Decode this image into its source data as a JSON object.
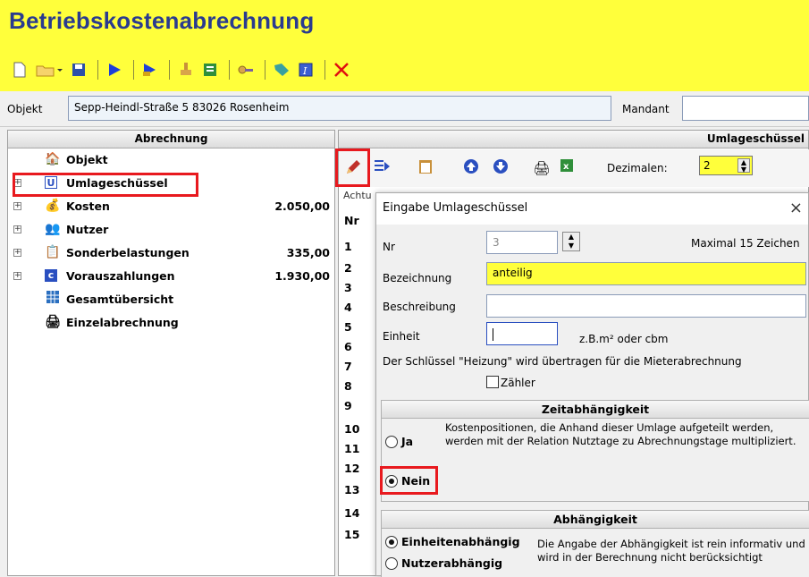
{
  "app": {
    "title": "Betriebskostenabrechnung"
  },
  "toolbar": {
    "icons": [
      "new-file-icon",
      "open-folder-icon",
      "save-icon",
      "run-icon",
      "run-all-icon",
      "stamp-icon",
      "list-icon",
      "key-icon",
      "tag-icon",
      "info-icon",
      "delete-icon"
    ]
  },
  "object": {
    "label": "Objekt",
    "value": "Sepp-Heindl-Straße 5  83026 Rosenheim",
    "mandant_label": "Mandant",
    "mandant_value": ""
  },
  "left": {
    "header": "Abrechnung",
    "items": [
      {
        "label": "Objekt",
        "value": ""
      },
      {
        "label": "Umlageschüssel",
        "value": ""
      },
      {
        "label": "Kosten",
        "value": "2.050,00"
      },
      {
        "label": "Nutzer",
        "value": ""
      },
      {
        "label": "Sonderbelastungen",
        "value": "335,00"
      },
      {
        "label": "Vorauszahlungen",
        "value": "1.930,00"
      },
      {
        "label": "Gesamtübersicht",
        "value": ""
      },
      {
        "label": "Einzelabrechnung",
        "value": ""
      }
    ]
  },
  "right": {
    "header": "Umlageschüssel",
    "dezimalen_label": "Dezimalen:",
    "dezimalen_value": "2",
    "hint_text": "Achtu",
    "nr_header": "Nr",
    "rows": [
      "1",
      "2",
      "3",
      "4",
      "5",
      "6",
      "7",
      "8",
      "9",
      "10",
      "11",
      "12",
      "13",
      "14",
      "15"
    ]
  },
  "dialog": {
    "title": "Eingabe Umlageschüssel",
    "close": "×",
    "nr_label": "Nr",
    "nr_value": "3",
    "max_note": "Maximal 15 Zeichen",
    "bez_label": "Bezeichnung",
    "bez_value": "anteilig",
    "besch_label": "Beschreibung",
    "besch_value": "",
    "einheit_label": "Einheit",
    "einheit_value": "",
    "einheit_hint": "z.B.m² oder cbm",
    "heizung_note": "Der Schlüssel \"Heizung\" wird übertragen für die Mieterabrechnung",
    "zaehler_label": "Zähler",
    "zeit": {
      "header": "Zeitabhängigkeit",
      "ja": "Ja",
      "nein": "Nein",
      "text": "Kostenpositionen, die Anhand dieser Umlage aufgeteilt werden, werden mit der Relation Nutztage zu Abrechnungstage multipliziert."
    },
    "abh": {
      "header": "Abhängigkeit",
      "einheiten": "Einheitenabhängig",
      "nutzer": "Nutzerabhängig",
      "text": "Die Angabe der Abhängigkeit ist rein informativ und wird in der Berechnung nicht berücksichtigt"
    }
  }
}
